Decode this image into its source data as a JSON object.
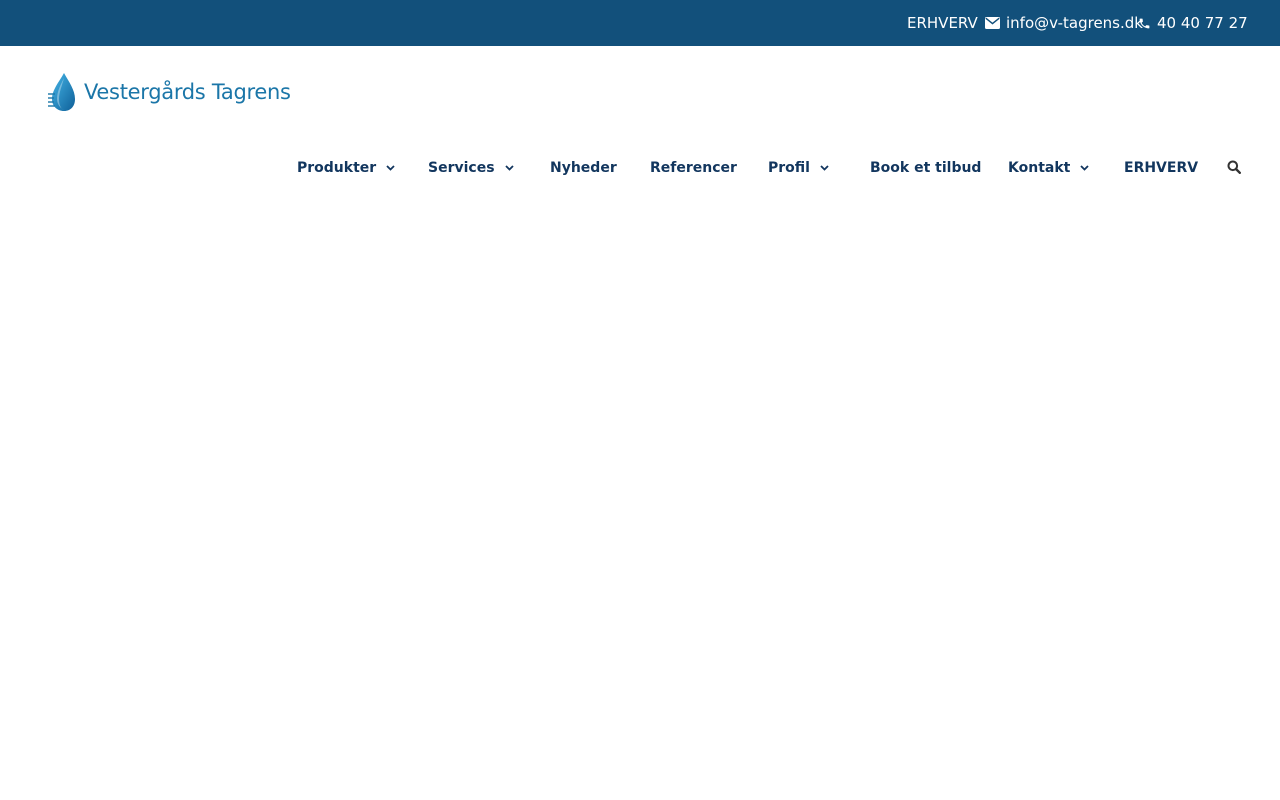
{
  "topbar": {
    "erhverv_label": "ERHVERV",
    "email": "info@v-tagrens.dk",
    "phone": "40 40 77 27",
    "background_color": "#12507b",
    "email_icon": "envelope-icon",
    "phone_icon": "phone-icon"
  },
  "logo": {
    "text": "Vestergårds Tagrens",
    "icon": "water-drop-icon",
    "color": "#1b76a8"
  },
  "nav": {
    "items": [
      {
        "label": "Produkter",
        "has_dropdown": true
      },
      {
        "label": "Services",
        "has_dropdown": true
      },
      {
        "label": "Nyheder",
        "has_dropdown": false
      },
      {
        "label": "Referencer",
        "has_dropdown": false
      },
      {
        "label": "Profil",
        "has_dropdown": true
      },
      {
        "label": "Book et tilbud",
        "has_dropdown": false
      },
      {
        "label": "Kontakt",
        "has_dropdown": true
      },
      {
        "label": "ERHVERV",
        "has_dropdown": false
      }
    ],
    "search_icon": "search-icon",
    "text_color": "#12365e"
  }
}
